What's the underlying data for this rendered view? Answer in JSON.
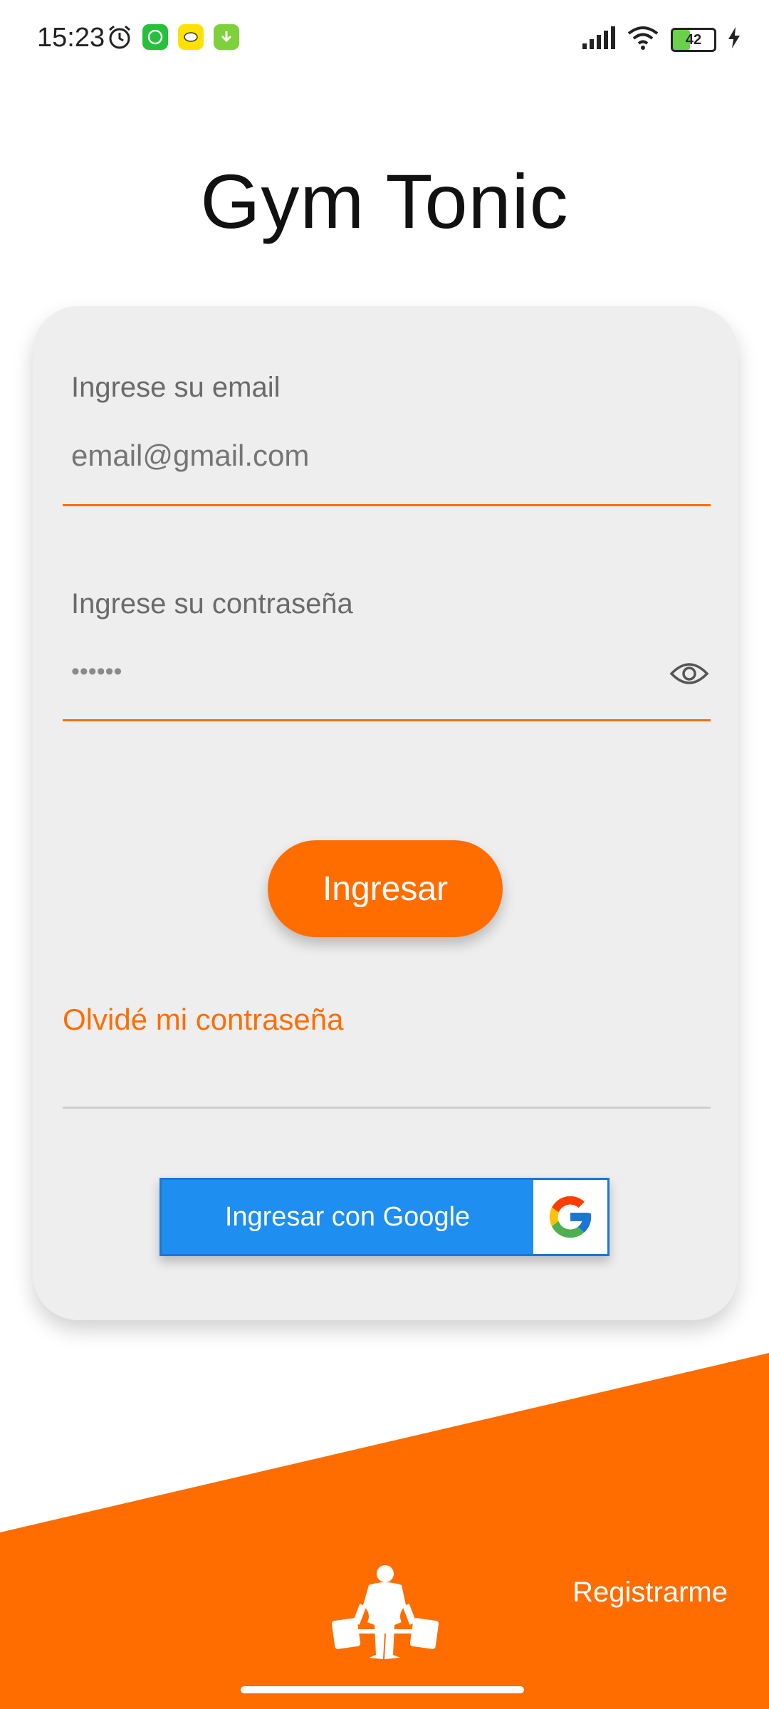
{
  "status": {
    "time": "15:23",
    "battery": "42"
  },
  "app": {
    "title": "Gym Tonic"
  },
  "login": {
    "email_label": "Ingrese su email",
    "email_placeholder": "email@gmail.com",
    "password_label": "Ingrese su contraseña",
    "password_value": "••••••",
    "submit_label": "Ingresar",
    "forgot_label": "Olvidé mi contraseña",
    "google_label": "Ingresar con Google"
  },
  "footer": {
    "register_label": "Registrarme"
  },
  "colors": {
    "accent": "#ff6d00",
    "google_blue": "#1e8ef0",
    "card_bg": "#eeeeee"
  },
  "icons": [
    "alarm-icon",
    "whatsapp-icon",
    "emoji-app-icon",
    "download-icon",
    "signal-icon",
    "wifi-icon",
    "battery-icon",
    "charging-icon",
    "eye-icon",
    "google-g-icon",
    "weightlifter-icon"
  ]
}
